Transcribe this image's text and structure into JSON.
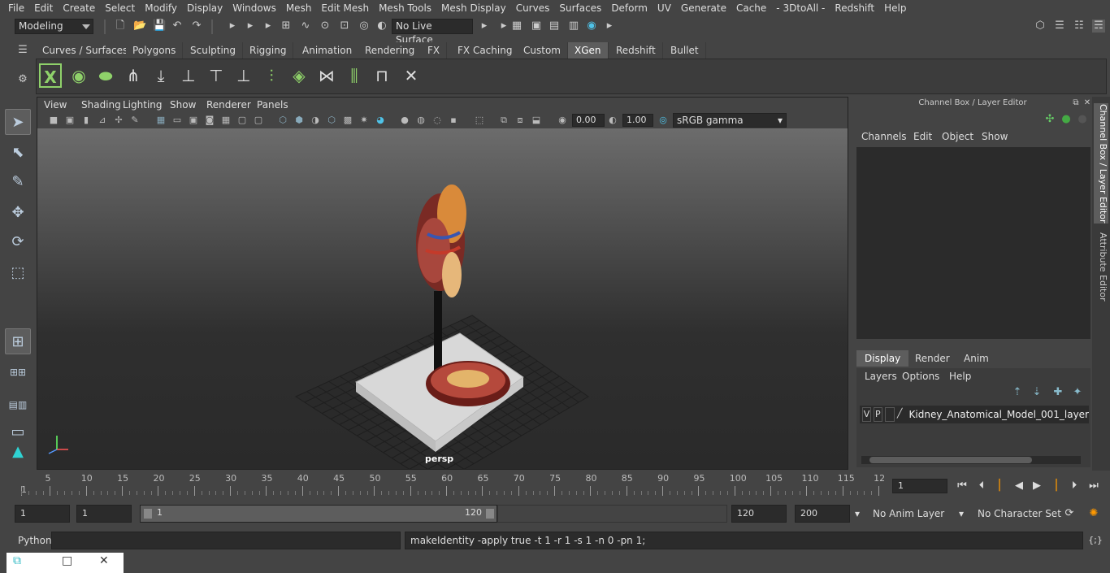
{
  "menubar": {
    "items": [
      "File",
      "Edit",
      "Create",
      "Select",
      "Modify",
      "Display",
      "Windows",
      "Mesh",
      "Edit Mesh",
      "Mesh Tools",
      "Mesh Display",
      "Curves",
      "Surfaces",
      "Deform",
      "UV",
      "Generate",
      "Cache",
      "- 3DtoAll -",
      "Redshift",
      "Help"
    ]
  },
  "statusline": {
    "mode": "Modeling",
    "live_surface": "No Live Surface"
  },
  "shelf": {
    "tabs": [
      "Curves / Surfaces",
      "Polygons",
      "Sculpting",
      "Rigging",
      "Animation",
      "Rendering",
      "FX",
      "FX Caching",
      "Custom",
      "XGen",
      "Redshift",
      "Bullet"
    ],
    "active_tab": "XGen",
    "icons": [
      "xgen-icon",
      "eye-icon",
      "leaf-icon",
      "add-guides-icon",
      "move-guide-icon",
      "place-guide-icon",
      "edit-guide-icon",
      "lock-guide-icon",
      "sculpt-guide-icon",
      "density-icon",
      "cut-icon",
      "comb-icon",
      "width-icon",
      "brush-icon"
    ]
  },
  "viewport": {
    "menu": [
      "View",
      "Shading",
      "Lighting",
      "Show",
      "Renderer",
      "Panels"
    ],
    "exposure": "0.00",
    "gamma_value": "1.00",
    "color_space": "sRGB gamma",
    "camera_label": "persp"
  },
  "channelbox": {
    "title": "Channel Box / Layer Editor",
    "menu": [
      "Channels",
      "Edit",
      "Object",
      "Show"
    ],
    "layer_tabs": [
      "Display",
      "Render",
      "Anim"
    ],
    "active_layer_tab": "Display",
    "layer_menu": [
      "Layers",
      "Options",
      "Help"
    ],
    "layer": {
      "v": "V",
      "p": "P",
      "name": "Kidney_Anatomical_Model_001_layer"
    }
  },
  "side_tabs": [
    "Channel Box / Layer Editor",
    "Attribute Editor"
  ],
  "timeline": {
    "ticks": [
      "1",
      "5",
      "10",
      "15",
      "20",
      "25",
      "30",
      "35",
      "40",
      "45",
      "50",
      "55",
      "60",
      "65",
      "70",
      "75",
      "80",
      "85",
      "90",
      "95",
      "100",
      "105",
      "110",
      "115",
      "12"
    ],
    "current_frame": "1"
  },
  "range": {
    "start": "1",
    "playback_start": "1",
    "slider_start": "1",
    "slider_end": "120",
    "playback_end": "120",
    "end": "200",
    "anim_layer": "No Anim Layer",
    "character_set": "No Character Set"
  },
  "cmdline": {
    "label": "Python",
    "result": "makeIdentity -apply true -t 1 -r 1 -s 1 -n 0 -pn 1;"
  },
  "colors": {
    "bg": "#444444",
    "field": "#2b2b2b",
    "accent_green": "#8fd16a",
    "active_tab": "#5d5d5d"
  }
}
